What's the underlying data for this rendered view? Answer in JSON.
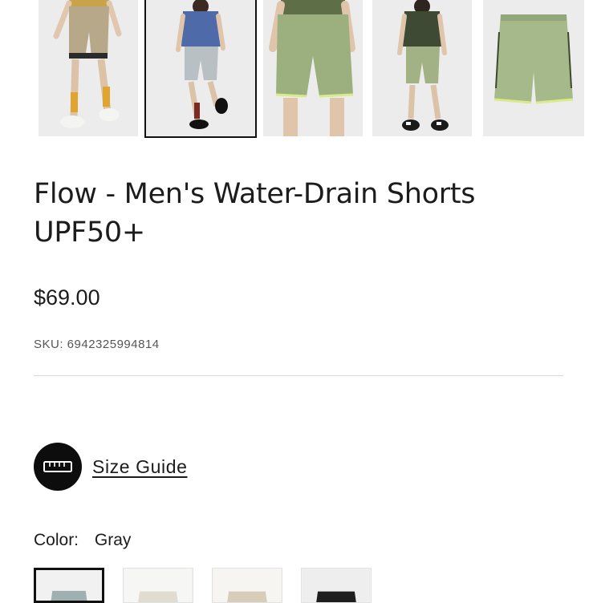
{
  "product": {
    "title": "Flow - Men's Water-Drain Shorts UPF50+",
    "price": "$69.00",
    "sku": "SKU: 6942325994814"
  },
  "gallery": {
    "thumbnails": [
      {
        "name": "model-khaki-shorts-thumb",
        "shorts_color": "#b7a88a",
        "shirt_color": "#c9a24a"
      },
      {
        "name": "model-gray-shorts-thumb",
        "shorts_color": "#b9c0c4",
        "shirt_color": "#4f6aa8",
        "selected": true
      },
      {
        "name": "green-shorts-closeup-thumb",
        "shorts_color": "#9bb07e",
        "shirt_color": "#5e6e46"
      },
      {
        "name": "model-green-shorts-thumb",
        "shorts_color": "#a2b285",
        "shirt_color": "#3e4a33"
      },
      {
        "name": "green-shorts-flatlay-thumb",
        "shorts_color": "#a5b98a",
        "trim_color": "#d8ea8a"
      }
    ]
  },
  "size_guide": {
    "label": "Size Guide",
    "icon": "ruler-icon"
  },
  "color": {
    "label": "Color:",
    "selected": "Gray",
    "swatches": [
      {
        "name": "gray",
        "color": "#9fb0b0",
        "selected": true
      },
      {
        "name": "off-white",
        "color": "#e0dcd0"
      },
      {
        "name": "beige",
        "color": "#d8cdb8"
      },
      {
        "name": "black",
        "color": "#1e1e1e"
      }
    ]
  }
}
